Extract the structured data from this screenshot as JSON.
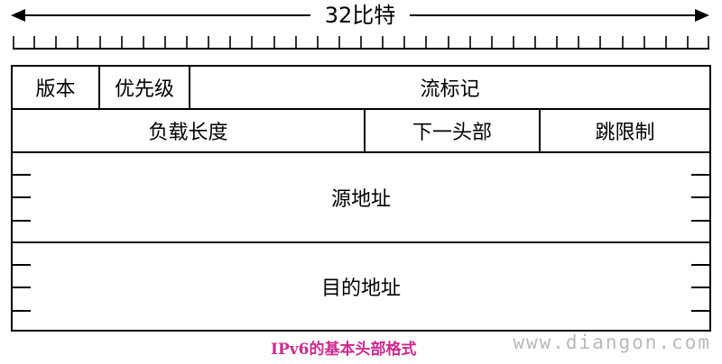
{
  "width_label": "32比特",
  "fields": {
    "version": "版本",
    "priority": "优先级",
    "flow_label": "流标记",
    "payload_length": "负载长度",
    "next_header": "下一头部",
    "hop_limit": "跳限制",
    "source_address": "源地址",
    "destination_address": "目的地址"
  },
  "caption": "IPv6的基本头部格式",
  "watermark": "www.diangon.com",
  "colors": {
    "caption": "#cc2a8f",
    "watermark": "#b9b9b9"
  }
}
